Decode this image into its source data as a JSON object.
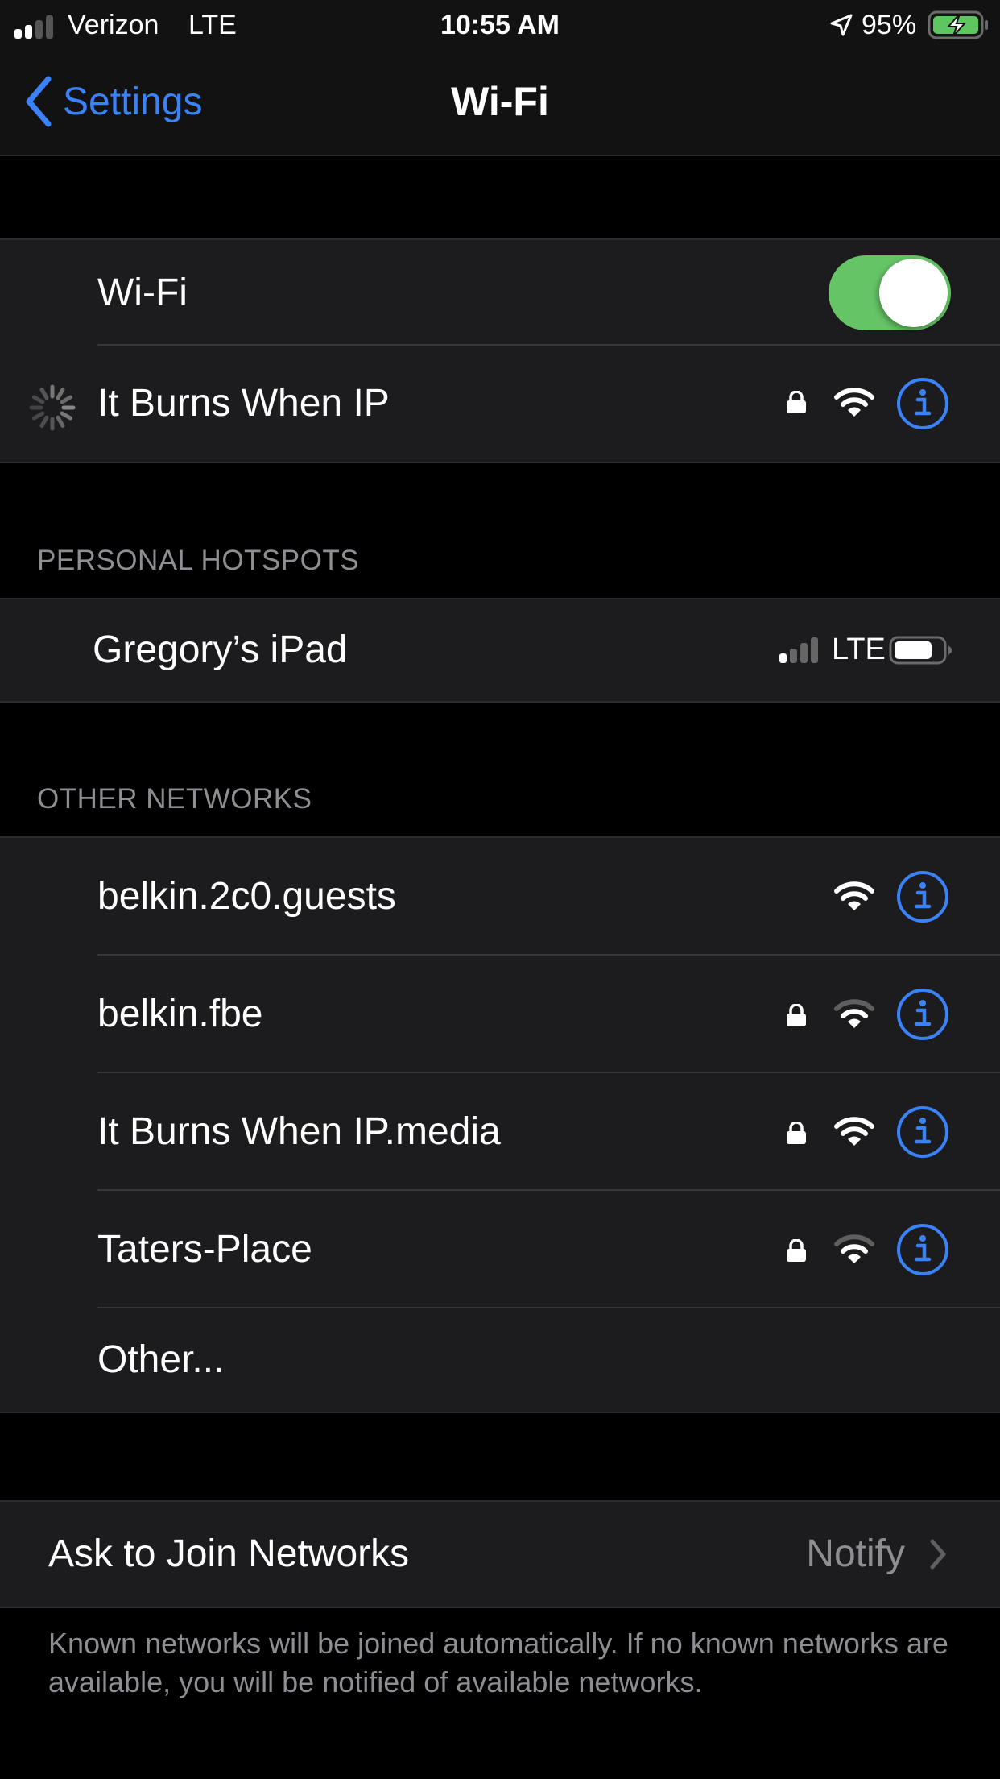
{
  "status_bar": {
    "carrier": "Verizon",
    "network_type": "LTE",
    "time": "10:55 AM",
    "battery_percent": "95%",
    "signal_bars_filled": 2,
    "signal_bars_total": 4,
    "charging": true,
    "location_active": true
  },
  "nav": {
    "back_label": "Settings",
    "title": "Wi-Fi"
  },
  "wifi_toggle": {
    "label": "Wi-Fi",
    "on": true
  },
  "current_network": {
    "name": "It Burns When IP",
    "status": "connecting",
    "secured": true,
    "signal_bars": 3
  },
  "personal_hotspots": {
    "header": "PERSONAL HOTSPOTS",
    "items": [
      {
        "name": "Gregory’s iPad",
        "network_type": "LTE",
        "signal_bars_filled": 1,
        "signal_bars_total": 4,
        "battery_level": "high"
      }
    ]
  },
  "other_networks": {
    "header": "OTHER NETWORKS",
    "items": [
      {
        "name": "belkin.2c0.guests",
        "secured": false,
        "signal_bars": 3
      },
      {
        "name": "belkin.fbe",
        "secured": true,
        "signal_bars": 2
      },
      {
        "name": "It Burns When IP.media",
        "secured": true,
        "signal_bars": 3
      },
      {
        "name": "Taters-Place",
        "secured": true,
        "signal_bars": 2
      }
    ],
    "other_label": "Other..."
  },
  "ask_to_join": {
    "label": "Ask to Join Networks",
    "value": "Notify",
    "footer": "Known networks will be joined automatically. If no known networks are available, you will be notified of available networks."
  },
  "colors": {
    "accent": "#3a82f7",
    "toggle_on": "#65c466",
    "cell_bg": "#1c1c1e",
    "page_bg": "#000000",
    "secondary_text": "#8d8d92"
  }
}
